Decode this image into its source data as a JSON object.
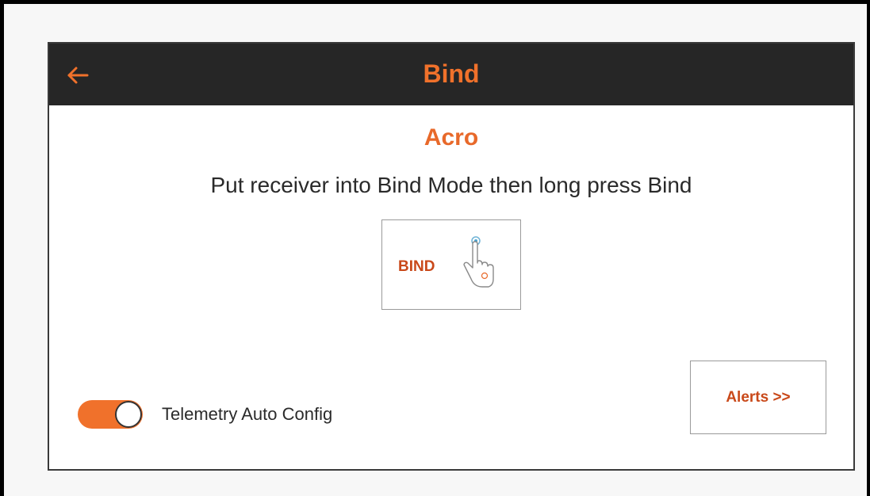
{
  "header": {
    "title": "Bind",
    "back_icon": "arrow-left-icon"
  },
  "main": {
    "model_name": "Acro",
    "instruction": "Put receiver into Bind Mode then long press Bind",
    "bind_button_label": "BIND",
    "bind_button_icon": "finger-press-icon"
  },
  "footer": {
    "telemetry_toggle_label": "Telemetry Auto Config",
    "telemetry_toggle_on": true,
    "alerts_button_label": "Alerts >>"
  },
  "colors": {
    "accent": "#f0712b",
    "header_bg": "#262626",
    "button_text": "#c9491a"
  }
}
